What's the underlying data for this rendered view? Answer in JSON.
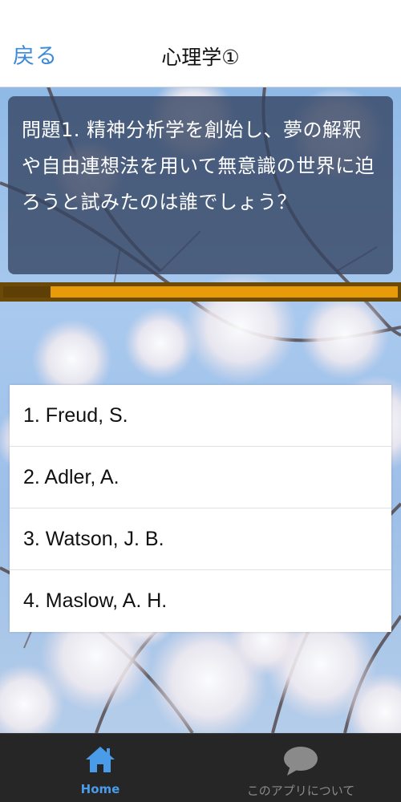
{
  "navbar": {
    "back_label": "戻る",
    "title": "心理学①"
  },
  "question": {
    "text": "問題1. 精神分析学を創始し、夢の解釈や自由連想法を用いて無意識の世界に迫ろうと試みたのは誰でしょう？"
  },
  "progress": {
    "fraction": 0.12
  },
  "answers": [
    {
      "label": "1. Freud, S."
    },
    {
      "label": "2. Adler, A."
    },
    {
      "label": "3. Watson, J. B."
    },
    {
      "label": "4. Maslow, A. H."
    }
  ],
  "tabbar": {
    "home_label": "Home",
    "home_icon": "home-icon",
    "about_label": "このアプリについて",
    "about_icon": "speech-bubble-icon"
  },
  "colors": {
    "accent": "#3d8ad8",
    "progress": "#e79b09",
    "tabbar": "#262626"
  }
}
